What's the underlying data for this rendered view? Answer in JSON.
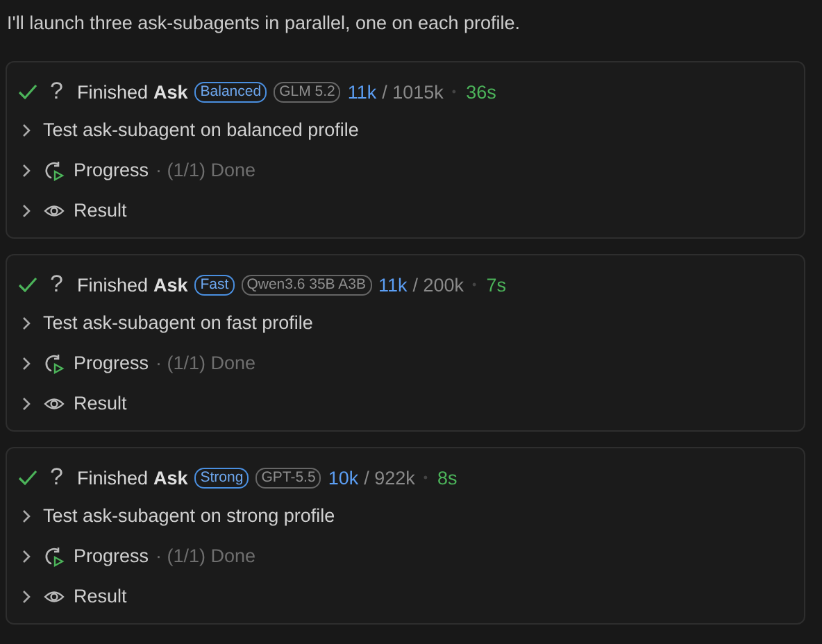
{
  "intro": "I'll launch three ask-subagents in parallel, one on each profile.",
  "tasks": [
    {
      "done": true,
      "mark": "?",
      "title": "Finished",
      "action": "Ask",
      "profile": "Balanced",
      "model": "GLM 5.2",
      "tokens": "11k",
      "limit": "/ 1015k",
      "dot": "•",
      "duration": "36s",
      "rows": [
        {
          "kind": "text",
          "label": "Test ask-subagent on balanced profile",
          "expanded": false
        },
        {
          "kind": "progress",
          "label": "Progress",
          "detail": "· (1/1) Done",
          "expanded": false
        },
        {
          "kind": "result",
          "label": "Result",
          "expanded": false
        }
      ]
    },
    {
      "done": true,
      "mark": "?",
      "title": "Finished",
      "action": "Ask",
      "profile": "Fast",
      "model": "Qwen3.6 35B A3B",
      "tokens": "11k",
      "limit": "/ 200k",
      "dot": "•",
      "duration": "7s",
      "rows": [
        {
          "kind": "text",
          "label": "Test ask-subagent on fast profile",
          "expanded": false
        },
        {
          "kind": "progress",
          "label": "Progress",
          "detail": "· (1/1) Done",
          "expanded": false
        },
        {
          "kind": "result",
          "label": "Result",
          "expanded": false
        }
      ]
    },
    {
      "done": true,
      "mark": "?",
      "title": "Finished",
      "action": "Ask",
      "profile": "Strong",
      "model": "GPT-5.5",
      "tokens": "10k",
      "limit": "/ 922k",
      "dot": "•",
      "duration": "8s",
      "rows": [
        {
          "kind": "text",
          "label": "Test ask-subagent on strong profile",
          "expanded": false
        },
        {
          "kind": "progress",
          "label": "Progress",
          "detail": "· (1/1) Done",
          "expanded": false
        },
        {
          "kind": "result",
          "label": "Result",
          "expanded": false
        }
      ]
    }
  ]
}
